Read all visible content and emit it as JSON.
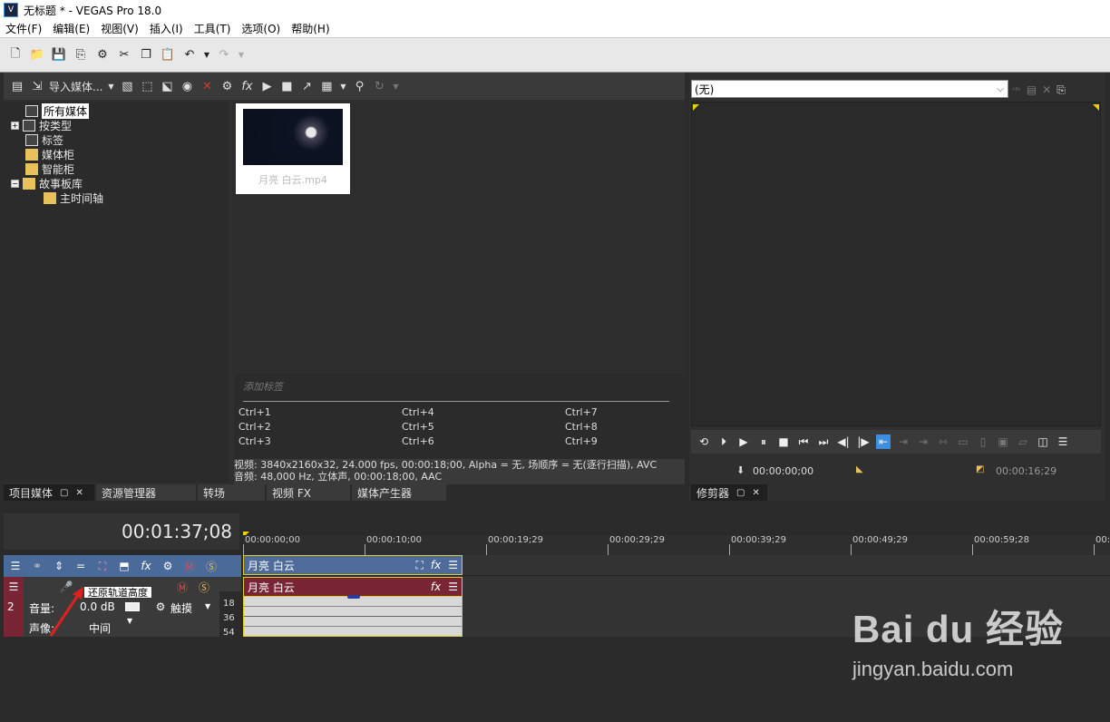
{
  "window": {
    "title": "无标题 * - VEGAS Pro 18.0",
    "logo": "V"
  },
  "menu": [
    "文件(F)",
    "编辑(E)",
    "视图(V)",
    "插入(I)",
    "工具(T)",
    "选项(O)",
    "帮助(H)"
  ],
  "media_panel": {
    "import_label": "导入媒体...",
    "tree": [
      {
        "label": "所有媒体",
        "selected": true
      },
      {
        "label": "按类型"
      },
      {
        "label": "标签"
      },
      {
        "label": "媒体柜"
      },
      {
        "label": "智能柜"
      },
      {
        "label": "故事板库"
      },
      {
        "label": "主时间轴"
      }
    ],
    "thumb_name": "月亮 白云.mp4",
    "tag_hint": "添加标签",
    "shortcuts": [
      "Ctrl+1",
      "Ctrl+2",
      "Ctrl+3",
      "Ctrl+4",
      "Ctrl+5",
      "Ctrl+6",
      "Ctrl+7",
      "Ctrl+8",
      "Ctrl+9"
    ],
    "info_video": "视频: 3840x2160x32, 24.000 fps, 00:00:18;00, Alpha = 无, 场顺序 = 无(逐行扫描), AVC",
    "info_audio": "音频: 48,000 Hz, 立体声, 00:00:18;00, AAC",
    "tabs": [
      "项目媒体",
      "资源管理器",
      "转场",
      "视频 FX",
      "媒体产生器"
    ]
  },
  "preview": {
    "select_value": "(无)",
    "time_in": "00:00:00;00",
    "time_out": "00:00:16;29",
    "tab": "修剪器"
  },
  "timeline": {
    "timecode": "00:01:37;08",
    "ruler": [
      "00:00:00;00",
      "00:00:10;00",
      "00:00:19;29",
      "00:00:29;29",
      "00:00:39;29",
      "00:00:49;29",
      "00:00:59;28",
      "00:0"
    ],
    "clip_video": "月亮 白云",
    "clip_audio": "月亮 白云",
    "track_number": "2",
    "volume_label": "音量:",
    "volume_value": "0.0 dB",
    "pan_label": "声像:",
    "pan_value": "中间",
    "touch_label": "触摸",
    "db_ticks": [
      "18",
      "36",
      "54"
    ],
    "tooltip": "还原轨道高度"
  },
  "watermark": {
    "brand": "Bai du 经验",
    "url": "jingyan.baidu.com"
  }
}
